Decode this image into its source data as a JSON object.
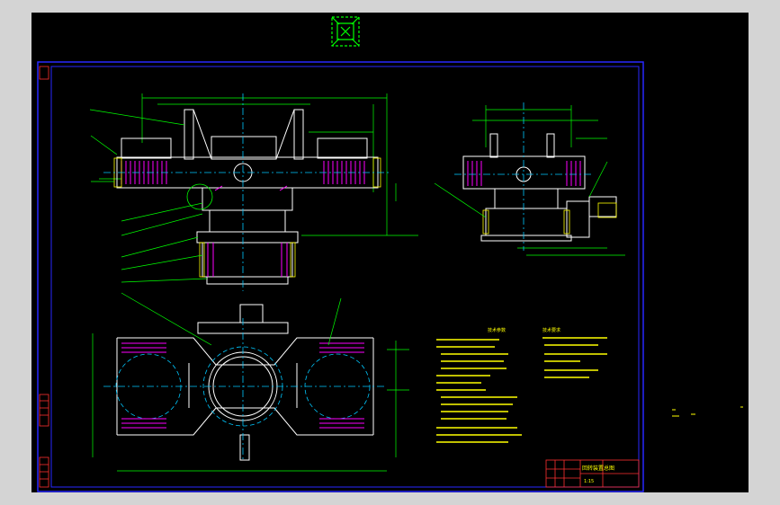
{
  "colors": {
    "background": "#000000",
    "window": "#d4d4d4",
    "border": "#0000ff",
    "geometry": "#ffffff",
    "dimension": "#00ff00",
    "centerline": "#00c8ff",
    "hatch": "#ff00ff",
    "leader": "#00ff00",
    "notes": "#ffff00",
    "titleblock": "#ff3030"
  },
  "icons": {
    "viewcube": "green-viewcube-icon"
  },
  "notes": {
    "heading_left": "技术参数",
    "heading_right": "技术要求"
  },
  "titleblock": {
    "drawing_name": "回转装置总图",
    "scale": "1:15"
  }
}
